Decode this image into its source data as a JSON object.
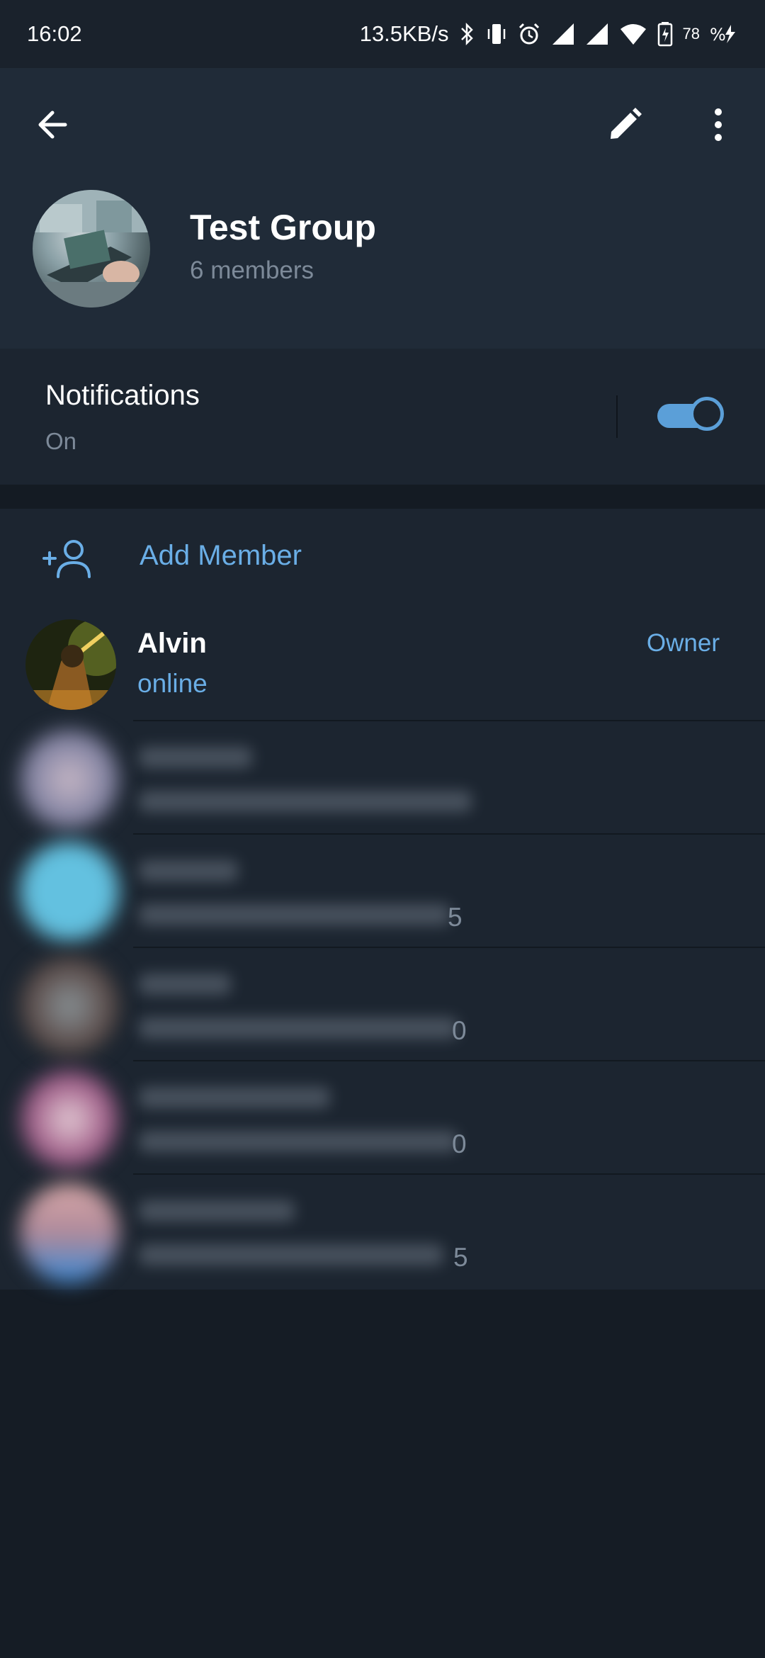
{
  "status_bar": {
    "time": "16:02",
    "net_speed": "13.5KB/s",
    "battery": "78",
    "icons": [
      "bluetooth-icon",
      "vibrate-icon",
      "alarm-icon",
      "signal-icon",
      "signal-icon",
      "wifi-icon",
      "battery-icon",
      "charging-icon"
    ]
  },
  "header": {
    "back_icon": "arrow-left-icon",
    "edit_icon": "pencil-icon",
    "more_icon": "more-vertical-icon",
    "title": "Test Group",
    "subtitle": "6 members"
  },
  "notifications": {
    "title": "Notifications",
    "value": "On",
    "enabled": true
  },
  "members_section": {
    "add_member_label": "Add Member",
    "add_member_icon": "add-person-icon",
    "owner": {
      "name": "Alvin",
      "status": "online",
      "role": "Owner"
    },
    "blurred_tail_chars": [
      "5",
      "0",
      "0",
      "5"
    ]
  },
  "colors": {
    "accent": "#6aaee6",
    "toggle": "#5b9fd8",
    "header_bg": "#202b38",
    "section_bg": "#1c2530",
    "page_bg": "#151c25"
  }
}
